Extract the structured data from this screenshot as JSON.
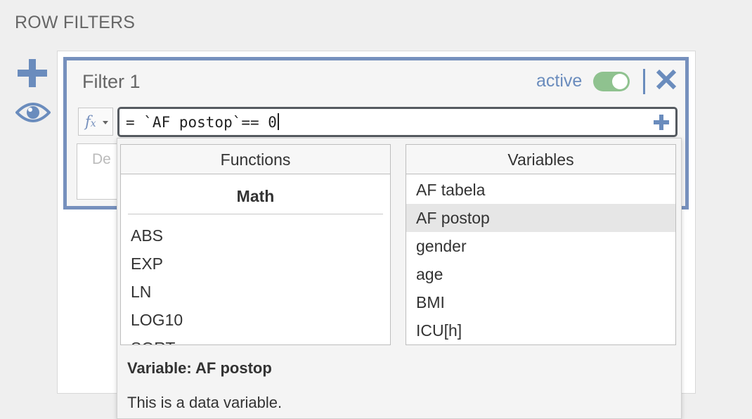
{
  "section_title": "ROW FILTERS",
  "sidebar": {
    "add_icon": "plus-icon",
    "preview_icon": "eye-icon"
  },
  "filter": {
    "title": "Filter 1",
    "active_label": "active",
    "active": true,
    "expression": "= `AF postop`== 0",
    "description_placeholder": "De"
  },
  "popup": {
    "functions": {
      "header": "Functions",
      "group": "Math",
      "items": [
        "ABS",
        "EXP",
        "LN",
        "LOG10",
        "SQRT"
      ]
    },
    "variables": {
      "header": "Variables",
      "items": [
        "AF tabela",
        "AF postop",
        "gender",
        "age",
        "BMI",
        "ICU[h]"
      ],
      "selected_index": 1
    },
    "info": {
      "title": "Variable: AF postop",
      "text": "This is a data variable."
    }
  },
  "colors": {
    "accent": "#7690bd",
    "toggle_on": "#8fc28f",
    "active_text": "#6a8cbd"
  }
}
